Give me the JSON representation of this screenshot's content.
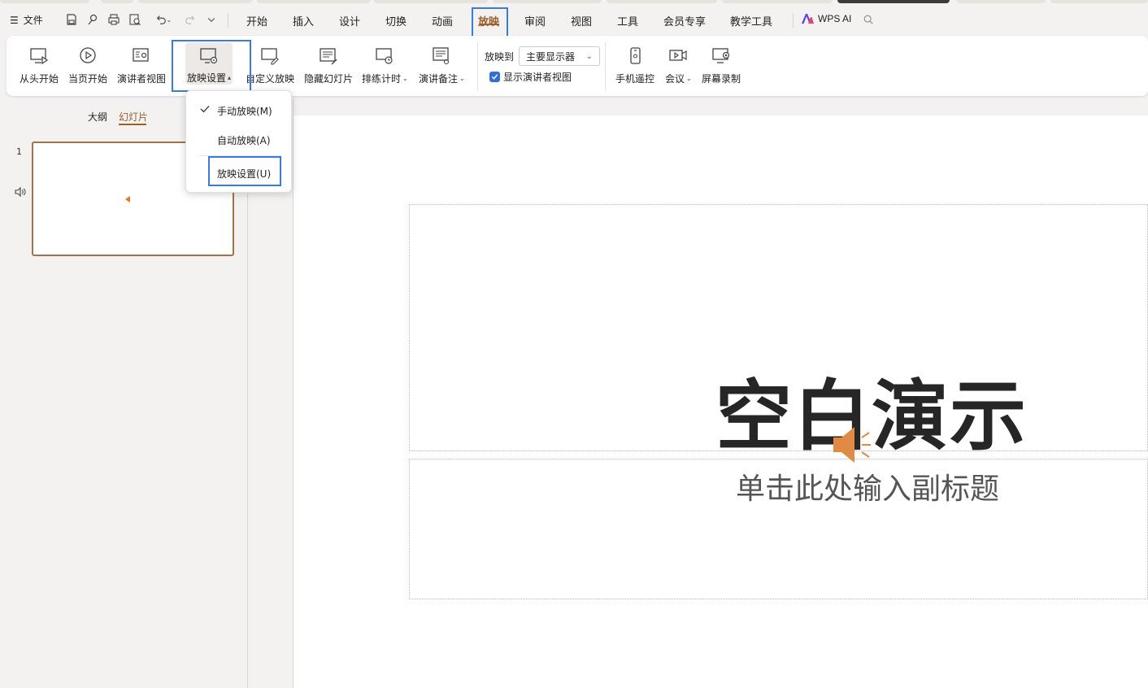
{
  "menu": {
    "file_label": "文件",
    "tabs": [
      "开始",
      "插入",
      "设计",
      "切换",
      "动画",
      "放映",
      "审阅",
      "视图",
      "工具",
      "会员专享",
      "教学工具"
    ],
    "active_tab": "放映",
    "ai_label": "WPS AI"
  },
  "ribbon": {
    "from_start": "从头开始",
    "from_current": "当页开始",
    "presenter_view": "演讲者视图",
    "slideshow_settings": "放映设置",
    "custom_show": "自定义放映",
    "hide_slide": "隐藏幻灯片",
    "rehearse": "排练计时",
    "speaker_notes": "演讲备注",
    "play_to_label": "放映到",
    "monitor_value": "主要显示器",
    "show_presenter_label": "显示演讲者视图",
    "phone_remote": "手机遥控",
    "meeting": "会议",
    "screen_record": "屏幕录制"
  },
  "dropdown": {
    "manual": "手动放映(M)",
    "auto": "自动放映(A)",
    "settings": "放映设置(U)"
  },
  "panel": {
    "outline_tab": "大纲",
    "slides_tab": "幻灯片",
    "slide_number": "1"
  },
  "slide": {
    "title": "空白演示",
    "subtitle": "单击此处输入副标题"
  },
  "colors": {
    "accent": "#9a5f2b",
    "highlight": "#3a7be0",
    "checkbox": "#2f6fd6",
    "speaker": "#e08a43"
  }
}
